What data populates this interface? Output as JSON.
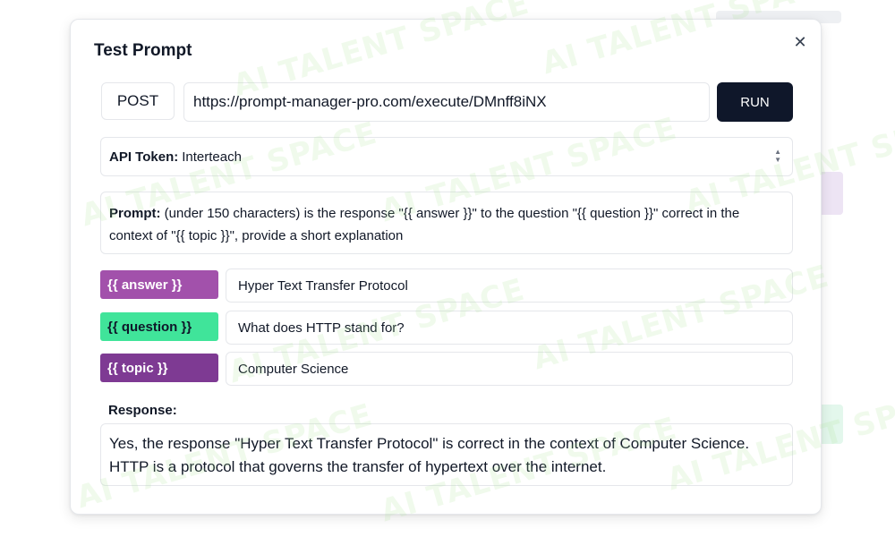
{
  "watermark": {
    "text": "AI TALENT SPACE",
    "color": "#aee696"
  },
  "modal": {
    "title": "Test Prompt",
    "close_icon": "close-icon"
  },
  "request": {
    "method": "POST",
    "url": "https://prompt-manager-pro.com/execute/DMnff8iNX",
    "run_label": "RUN"
  },
  "api_token": {
    "label": "API Token:",
    "value": "Interteach",
    "icon": "chevron-up-down-icon"
  },
  "prompt": {
    "label": "Prompt:",
    "text": "(under 150 characters) is the response \"{{ answer }}\" to the question \"{{ question }}\" correct in the context of \"{{ topic }}\", provide a short explanation"
  },
  "variables": [
    {
      "tag": "{{ answer }}",
      "value": "Hyper Text Transfer Protocol",
      "color": "#a251ab"
    },
    {
      "tag": "{{ question }}",
      "value": "What does HTTP stand for?",
      "color": "#40e49a"
    },
    {
      "tag": "{{ topic }}",
      "value": "Computer Science",
      "color": "#7e3a93"
    }
  ],
  "response": {
    "label": "Response:",
    "text": "Yes, the response \"Hyper Text Transfer Protocol\" is correct in the context of Computer Science. HTTP is a protocol that governs the transfer of hypertext over the internet."
  },
  "colors": {
    "run_button": "#0f172a",
    "border": "#e5e7eb"
  }
}
